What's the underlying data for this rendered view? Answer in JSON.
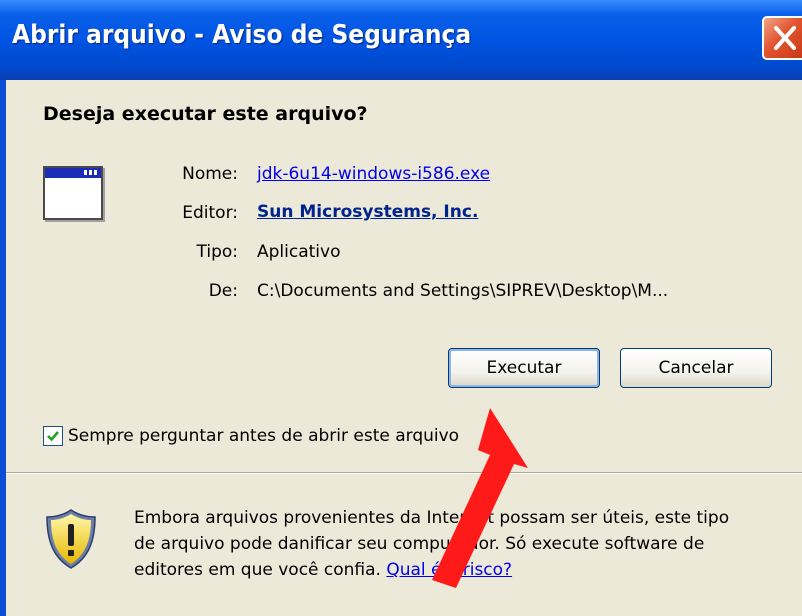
{
  "window": {
    "title": "Abrir arquivo - Aviso de Segurança",
    "close_icon": "close-x-icon"
  },
  "dialog": {
    "question": "Deseja executar este arquivo?",
    "app_icon": "application-window-icon",
    "fields": {
      "name_label": "Nome:",
      "name_value": "jdk-6u14-windows-i586.exe",
      "publisher_label": "Editor:",
      "publisher_value": "Sun Microsystems, Inc.",
      "type_label": "Tipo:",
      "type_value": "Aplicativo",
      "from_label": "De:",
      "from_value": "C:\\Documents and Settings\\SIPREV\\Desktop\\M..."
    },
    "buttons": {
      "run_label": "Executar",
      "cancel_label": "Cancelar"
    },
    "checkbox": {
      "label": "Sempre perguntar antes de abrir este arquivo",
      "checked": true
    },
    "warning": {
      "icon": "security-shield-warning-icon",
      "text": "Embora arquivos provenientes da Internet possam ser úteis, este tipo de arquivo pode danificar seu computador. Só execute software de editores em que você confia.",
      "link_label": "Qual é o risco?"
    }
  },
  "annotation": {
    "arrow_icon": "red-arrow-icon",
    "color": "#ff1a1a"
  }
}
